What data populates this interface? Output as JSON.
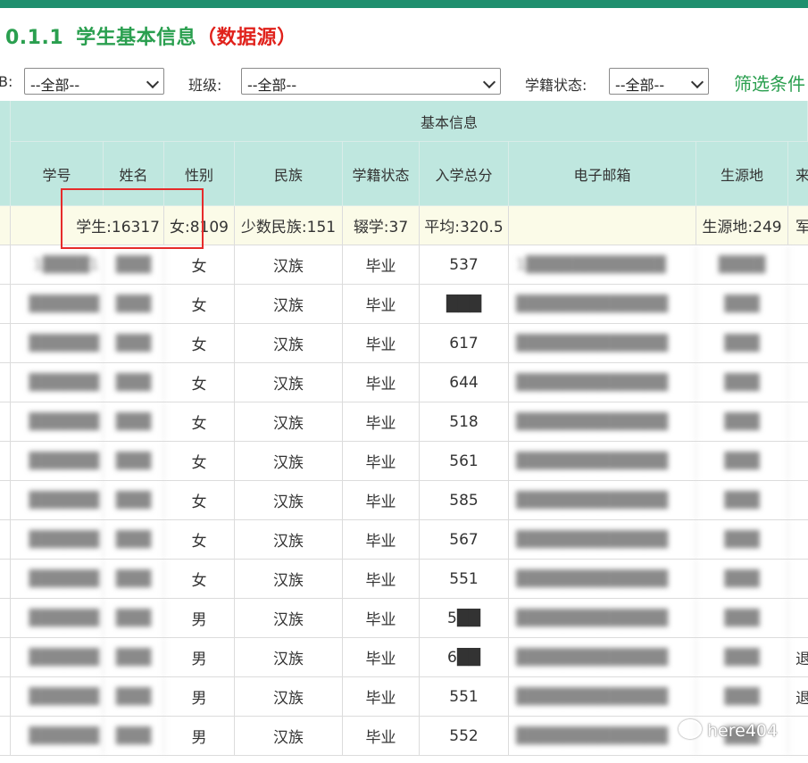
{
  "title": {
    "number": "0.1.1",
    "text": "学生基本信息",
    "source": "（数据源）"
  },
  "filters": {
    "first_label_fragment": "B:",
    "first_value": "--全部--",
    "class_label": "班级:",
    "class_value": "--全部--",
    "status_label": "学籍状态:",
    "status_value": "--全部--",
    "filter_link": "筛选条件"
  },
  "table": {
    "group_header": "基本信息",
    "columns": [
      "学号",
      "姓名",
      "性别",
      "民族",
      "学籍状态",
      "入学总分",
      "电子邮箱",
      "生源地",
      "来"
    ],
    "summary": {
      "students": "学生:16317",
      "female": "女:8109",
      "minority": "少数民族:151",
      "dropout": "辍学:37",
      "avg_score": "平均:320.5",
      "email": "",
      "origin": "生源地:249",
      "extra": "军"
    },
    "rows": [
      {
        "id": "1████1",
        "name": "███",
        "gender": "女",
        "ethnic": "汉族",
        "status": "毕业",
        "score": "537",
        "email": "1████████████",
        "origin": "████",
        "extra": ""
      },
      {
        "id": "██████",
        "name": "███",
        "gender": "女",
        "ethnic": "汉族",
        "status": "毕业",
        "score": "███",
        "email": "█████████████",
        "origin": "███",
        "extra": ""
      },
      {
        "id": "██████",
        "name": "███",
        "gender": "女",
        "ethnic": "汉族",
        "status": "毕业",
        "score": "617",
        "email": "█████████████",
        "origin": "███",
        "extra": ""
      },
      {
        "id": "██████",
        "name": "███",
        "gender": "女",
        "ethnic": "汉族",
        "status": "毕业",
        "score": "644",
        "email": "█████████████",
        "origin": "███",
        "extra": ""
      },
      {
        "id": "██████",
        "name": "███",
        "gender": "女",
        "ethnic": "汉族",
        "status": "毕业",
        "score": "518",
        "email": "█████████████",
        "origin": "███",
        "extra": ""
      },
      {
        "id": "██████",
        "name": "███",
        "gender": "女",
        "ethnic": "汉族",
        "status": "毕业",
        "score": "561",
        "email": "█████████████",
        "origin": "███",
        "extra": ""
      },
      {
        "id": "██████",
        "name": "███",
        "gender": "女",
        "ethnic": "汉族",
        "status": "毕业",
        "score": "585",
        "email": "█████████████",
        "origin": "███",
        "extra": ""
      },
      {
        "id": "██████",
        "name": "███",
        "gender": "女",
        "ethnic": "汉族",
        "status": "毕业",
        "score": "567",
        "email": "█████████████",
        "origin": "███",
        "extra": ""
      },
      {
        "id": "██████",
        "name": "███",
        "gender": "女",
        "ethnic": "汉族",
        "status": "毕业",
        "score": "551",
        "email": "█████████████",
        "origin": "███",
        "extra": ""
      },
      {
        "id": "██████",
        "name": "███",
        "gender": "男",
        "ethnic": "汉族",
        "status": "毕业",
        "score": "5██",
        "email": "█████████████",
        "origin": "███",
        "extra": ""
      },
      {
        "id": "██████",
        "name": "███",
        "gender": "男",
        "ethnic": "汉族",
        "status": "毕业",
        "score": "6██",
        "email": "█████████████",
        "origin": "███",
        "extra": "退"
      },
      {
        "id": "██████",
        "name": "███",
        "gender": "男",
        "ethnic": "汉族",
        "status": "毕业",
        "score": "551",
        "email": "█████████████",
        "origin": "███",
        "extra": "退"
      },
      {
        "id": "██████",
        "name": "███",
        "gender": "男",
        "ethnic": "汉族",
        "status": "毕业",
        "score": "552",
        "email": "█████████████",
        "origin": "███",
        "extra": ""
      }
    ]
  },
  "watermark": "here404",
  "colors": {
    "accent_green": "#2a9f4f",
    "source_red": "#e0211b",
    "header_bg": "#bfe7df",
    "summary_bg": "#fbfbe8",
    "highlight_box": "#e62b2b"
  }
}
